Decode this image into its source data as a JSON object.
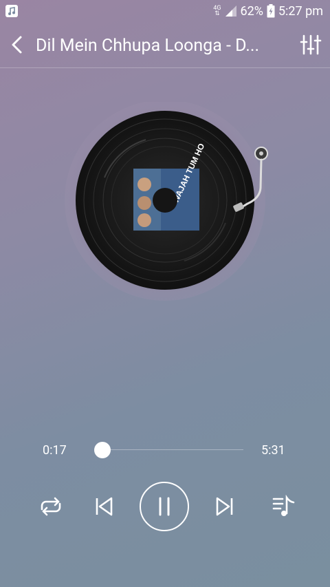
{
  "status_bar": {
    "network": "4G",
    "battery": "62%",
    "time": "5:27 pm",
    "icons": [
      "music-app-icon",
      "network-4g-icon",
      "signal-icon",
      "battery-icon"
    ]
  },
  "header": {
    "title": "Dil Mein Chhupa Loonga - D...",
    "icons": [
      "back-icon",
      "equalizer-icon"
    ]
  },
  "player": {
    "elapsed": "0:17",
    "total": "5:31",
    "progress": 0.05,
    "album_art_text": "WAJAH TUM HO",
    "controls": [
      "repeat-icon",
      "previous-icon",
      "pause-icon",
      "next-icon",
      "playlist-icon"
    ]
  },
  "colors": {
    "bg_top": "#9a85a3",
    "bg_bottom": "#7a8f9f",
    "foreground": "#ffffff"
  }
}
